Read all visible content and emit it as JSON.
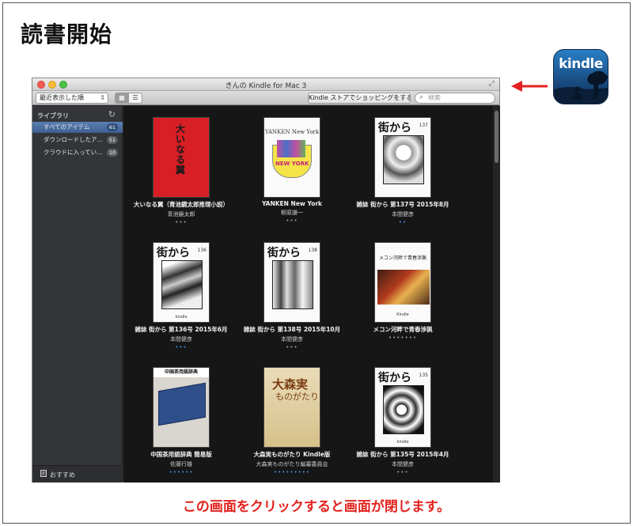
{
  "page": {
    "heading": "読書開始",
    "caption": "この画面をクリックすると画面が閉じます。",
    "accent_color": "#e3211d"
  },
  "kindle_icon": {
    "text": "kindle",
    "icon": "kindle-app-icon"
  },
  "window": {
    "title": "きんの Kindle for Mac 3",
    "toolbar": {
      "sort_value": "最近表示した順",
      "store_button": "Kindle ストアでショッピングをする",
      "search_placeholder": "検索"
    },
    "sidebar": {
      "header": "ライブラリ",
      "items": [
        {
          "label": "すべてのアイテム",
          "count": "61",
          "active": true
        },
        {
          "label": "ダウンロードしたア…",
          "count": "51",
          "active": false
        },
        {
          "label": "クラウドに入ってい…",
          "count": "10",
          "active": false
        }
      ],
      "bottom_label": "おすすめ"
    },
    "books": [
      {
        "title": "大いなる翼（青池鏡太郎推理小説）",
        "author": "青池鏡太郎",
        "cover_text": "大いなる翼",
        "dots": "•••",
        "dots_color": "gray"
      },
      {
        "title": "YANKEN New York",
        "author": "柳原謙一",
        "cover_text": "YANKEN New York",
        "cover_sub": "NEW YORK",
        "dots": "•••",
        "dots_color": "gray"
      },
      {
        "title": "雑誌 街から 第137号 2015年8月",
        "author": "本間健彦",
        "cover_text": "街から",
        "cover_num": "137",
        "dots": "••",
        "dots_color": "blue"
      },
      {
        "title": "雑誌 街から 第136号 2015年6月",
        "author": "本間健彦",
        "cover_text": "街から",
        "cover_num": "136",
        "cover_footer": "kindle",
        "dots": "•••",
        "dots_color": "blue"
      },
      {
        "title": "雑誌 街から 第138号 2015年10月",
        "author": "本間健彦",
        "cover_text": "街から",
        "cover_num": "138",
        "dots": "•••",
        "dots_color": "gray"
      },
      {
        "title": "メコン河畔で青春渉猟",
        "author": "",
        "cover_text": "メコン河畔で青春渉猟",
        "cover_footer": "Kindle",
        "dots": "•••••••",
        "dots_color": "gray"
      },
      {
        "title": "中国茶用語辞典 簡易版",
        "author": "佐藤行雄",
        "cover_text": "中国茶用語辞典",
        "dots": "••••••",
        "dots_color": "blue"
      },
      {
        "title": "大森実ものがたり Kindle版",
        "author": "大森実ものがたり編纂委員会",
        "cover_text": "大森実",
        "cover_sub": "ものがたり",
        "dots": "•••••••••",
        "dots_color": "blue"
      },
      {
        "title": "雑誌 街から 第135号 2015年4月",
        "author": "本間健彦",
        "cover_text": "街から",
        "cover_num": "135",
        "cover_footer": "kindle",
        "dots": "•••",
        "dots_color": "gray"
      }
    ]
  }
}
